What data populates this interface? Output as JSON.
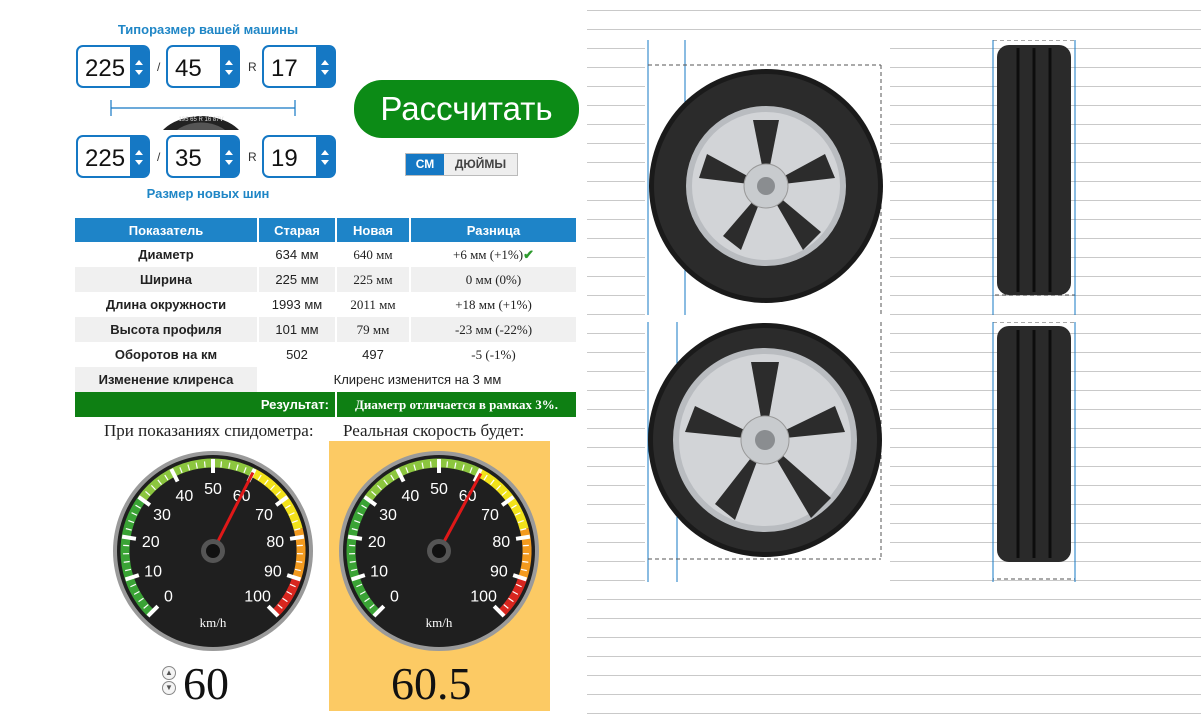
{
  "current": {
    "title": "Типоразмер вашей машины",
    "width": "225",
    "profile": "45",
    "rim": "17",
    "sep_slash": "/",
    "sep_r": "R"
  },
  "new": {
    "title": "Размер новых шин",
    "width": "225",
    "profile": "35",
    "rim": "19",
    "sep_slash": "/",
    "sep_r": "R"
  },
  "tire_badge_text": "195 65 R 16 87V",
  "actions": {
    "calculate": "Рассчитать"
  },
  "units": {
    "cm": "СМ",
    "inches": "ДЮЙМЫ",
    "selected": "cm"
  },
  "table": {
    "headers": [
      "Показатель",
      "Старая",
      "Новая",
      "Разница"
    ],
    "rows": [
      {
        "label": "Диаметр",
        "old": "634 мм",
        "new": "640 мм",
        "diff": "+6 мм (+1%)",
        "ok": true
      },
      {
        "label": "Ширина",
        "old": "225 мм",
        "new": "225 мм",
        "diff": "0 мм (0%)"
      },
      {
        "label": "Длина окружности",
        "old": "1993 мм",
        "new": "2011 мм",
        "diff": "+18 мм (+1%)"
      },
      {
        "label": "Высота профиля",
        "old": "101 мм",
        "new": "79 мм",
        "diff": "-23 мм (-22%)"
      },
      {
        "label": "Оборотов на км",
        "old": "502",
        "new": "497",
        "diff": "-5 (-1%)"
      }
    ],
    "clearance": {
      "label": "Изменение клиренса",
      "value": "Клиренс изменится на 3 мм"
    },
    "result": {
      "label": "Результат:",
      "value": "Диаметр отличается в рамках 3%."
    }
  },
  "speedometer": {
    "shown_caption": "При показаниях спидометра:",
    "real_caption": "Реальная скорость будет:",
    "unit": "km/h",
    "ticks": [
      "0",
      "10",
      "20",
      "30",
      "40",
      "50",
      "60",
      "70",
      "80",
      "90",
      "100"
    ],
    "shown_value": 60,
    "real_value": 60.5,
    "shown_text": "60",
    "real_text": "60.5"
  },
  "colors": {
    "accent_blue": "#1578c4",
    "button_green": "#0c8b16",
    "result_green": "#0e7f13",
    "real_bg": "#fcca64"
  },
  "icons": {
    "stepper_up": "chevron-up-icon",
    "stepper_down": "chevron-down-icon",
    "ok": "checkmark-icon"
  }
}
